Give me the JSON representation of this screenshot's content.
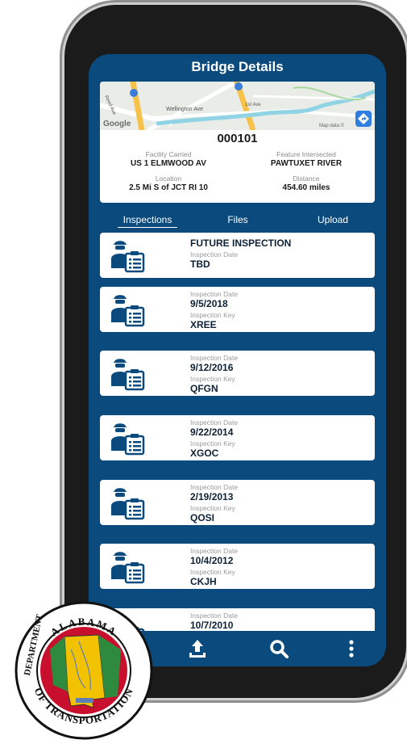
{
  "header": {
    "title": "Bridge Details"
  },
  "map": {
    "road1": "Wellington Ave",
    "road2": "1st Ave",
    "road3": "Reed Ave",
    "brand": "Google",
    "attribution": "Map data ©"
  },
  "bridge": {
    "id": "000101",
    "facility_label": "Facility Carried",
    "facility_value": "US 1 ELMWOOD AV",
    "feature_label": "Feature Intersected",
    "feature_value": "PAWTUXET RIVER",
    "location_label": "Location",
    "location_value": "2.5 Mi S of JCT RI 10",
    "distance_label": "Distance",
    "distance_value": "454.60 miles"
  },
  "tabs": [
    "Inspections",
    "Files",
    "Upload"
  ],
  "inspections": [
    {
      "title": "FUTURE INSPECTION",
      "date_label": "Inspection Date",
      "date": "TBD",
      "key_label": "",
      "key": ""
    },
    {
      "title": "",
      "date_label": "Inspection Date",
      "date": "9/5/2018",
      "key_label": "Inspection Key",
      "key": "XREE"
    },
    {
      "title": "",
      "date_label": "Inspection Date",
      "date": "9/12/2016",
      "key_label": "Inspection Key",
      "key": "QFGN"
    },
    {
      "title": "",
      "date_label": "Inspection Date",
      "date": "9/22/2014",
      "key_label": "Inspection Key",
      "key": "XGOC"
    },
    {
      "title": "",
      "date_label": "Inspection Date",
      "date": "2/19/2013",
      "key_label": "Inspection Key",
      "key": "QOSI"
    },
    {
      "title": "",
      "date_label": "Inspection Date",
      "date": "10/4/2012",
      "key_label": "Inspection Key",
      "key": "CKJH"
    },
    {
      "title": "",
      "date_label": "Inspection Date",
      "date": "10/7/2010",
      "key_label": "",
      "key": ""
    }
  ],
  "bottom_nav": {
    "icons": [
      "upload-icon",
      "search-icon",
      "more-vertical-icon"
    ]
  },
  "seal": {
    "top_text": "ALABAMA",
    "left_text": "DEPARTMENT",
    "bottom_text": "OF TRANSPORTATION",
    "accent_red": "#c8102e",
    "accent_yellow": "#f2c200",
    "accent_green": "#2e8b3d"
  },
  "colors": {
    "primary": "#0b4a7d",
    "card": "#ffffff",
    "text_dark": "#0d2238",
    "label": "#9a9a9a"
  }
}
